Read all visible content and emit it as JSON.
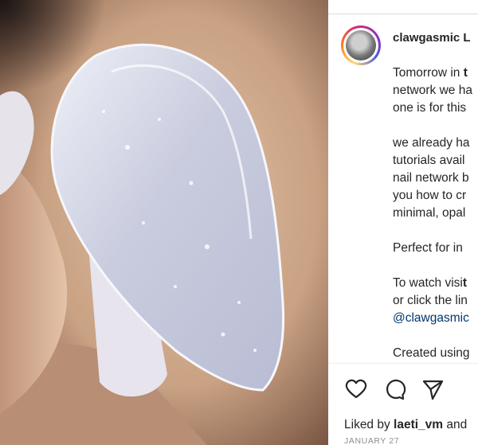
{
  "post": {
    "username": "clawgasmic L",
    "caption_lines": [
      {
        "pre": "Tomorrow in ",
        "bold": "t",
        "post": ""
      },
      {
        "pre": "network we ha",
        "bold": "",
        "post": ""
      },
      {
        "pre": "one is for this",
        "bold": "",
        "post": ""
      },
      {
        "pre": "",
        "bold": "",
        "post": ""
      },
      {
        "pre": "we already ha",
        "bold": "",
        "post": ""
      },
      {
        "pre": "tutorials avail",
        "bold": "",
        "post": ""
      },
      {
        "pre": "nail network b",
        "bold": "",
        "post": ""
      },
      {
        "pre": "you how to cr",
        "bold": "",
        "post": ""
      },
      {
        "pre": "minimal, opal",
        "bold": "",
        "post": ""
      },
      {
        "pre": "",
        "bold": "",
        "post": ""
      },
      {
        "pre": "Perfect for in",
        "bold": "",
        "post": ""
      },
      {
        "pre": "",
        "bold": "",
        "post": ""
      },
      {
        "pre": "To watch visi",
        "bold": "t",
        "post": ""
      },
      {
        "pre": "or click the lin",
        "bold": "",
        "post": ""
      },
      {
        "pre": "",
        "bold": "",
        "post": "",
        "link": "@clawgasmic"
      },
      {
        "pre": "",
        "bold": "",
        "post": ""
      },
      {
        "pre": "Created using",
        "bold": "",
        "post": ""
      }
    ],
    "likes_prefix": "Liked by ",
    "likes_user": "laeti_vm",
    "likes_suffix": " and",
    "date": "JANUARY 27"
  },
  "actions": {
    "like_icon": "heart-icon",
    "comment_icon": "comment-icon",
    "share_icon": "paper-plane-icon"
  },
  "colors": {
    "text": "#262626",
    "link": "#00376b",
    "muted": "#8e8e8e",
    "divider": "#efefef"
  }
}
